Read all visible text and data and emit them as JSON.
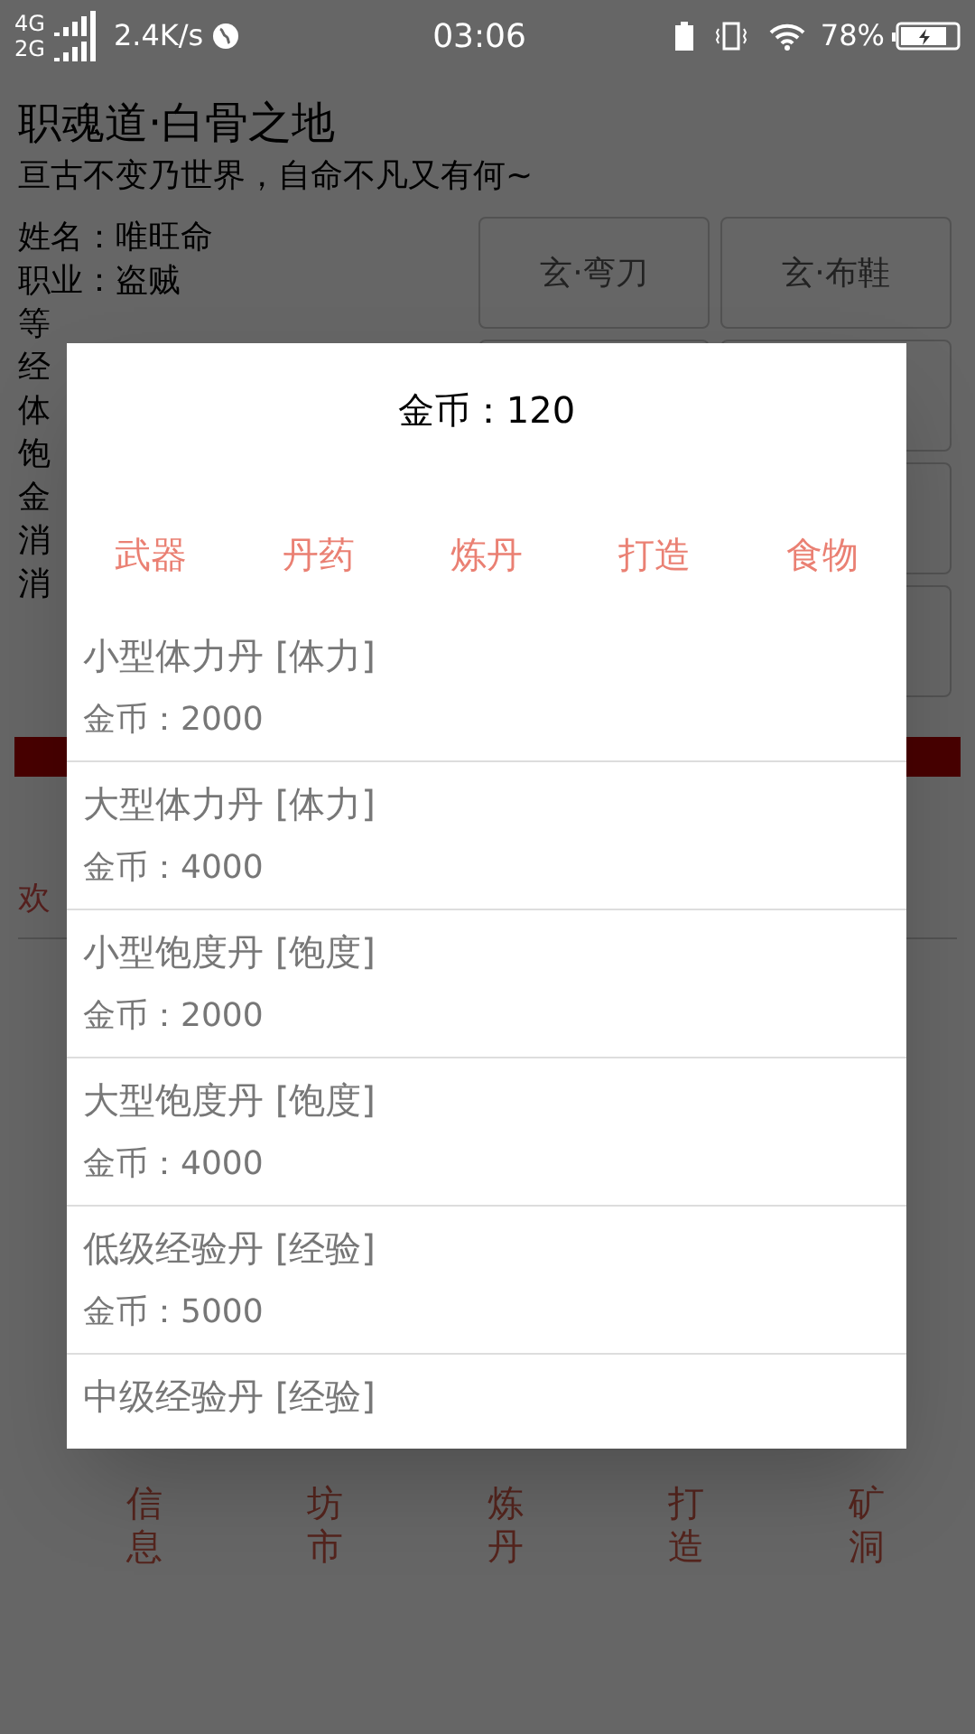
{
  "status_bar": {
    "network_top": "4G",
    "network_bottom": "2G",
    "speed": "2.4K/s",
    "time": "03:06",
    "battery": "78%"
  },
  "page": {
    "title": "职魂道·白骨之地",
    "subtitle": "亘古不变乃世界，自命不凡又有何~",
    "info": [
      "姓名：唯旺命",
      "职业：盗贼",
      "等",
      "经",
      "体",
      "饱",
      "金",
      "消",
      "消"
    ],
    "equipment": [
      "玄·弯刀",
      "玄·布鞋"
    ],
    "welcome": "欢",
    "nav": [
      {
        "label": "信息"
      },
      {
        "label": "坊市"
      },
      {
        "label": "炼丹"
      },
      {
        "label": "打造"
      },
      {
        "label": "矿洞"
      }
    ]
  },
  "dialog": {
    "gold": "金币：120",
    "tabs": [
      "武器",
      "丹药",
      "炼丹",
      "打造",
      "食物"
    ],
    "items": [
      {
        "name": "小型体力丹 [体力]",
        "price": "金币：2000"
      },
      {
        "name": "大型体力丹 [体力]",
        "price": "金币：4000"
      },
      {
        "name": "小型饱度丹 [饱度]",
        "price": "金币：2000"
      },
      {
        "name": "大型饱度丹 [饱度]",
        "price": "金币：4000"
      },
      {
        "name": "低级经验丹 [经验]",
        "price": "金币：5000"
      },
      {
        "name": "中级经验丹 [经验]"
      }
    ]
  }
}
